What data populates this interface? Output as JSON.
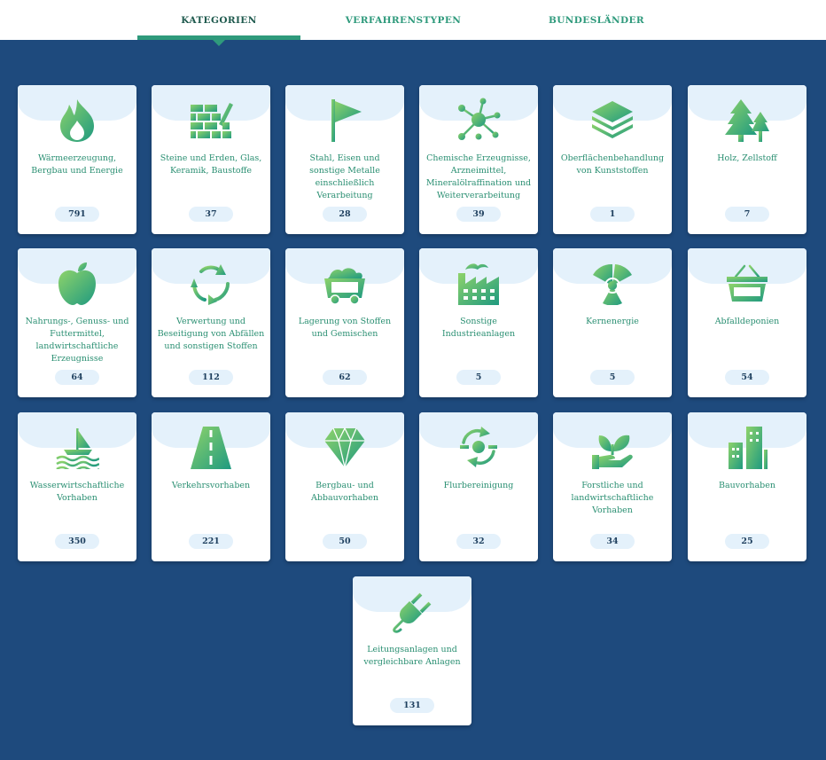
{
  "tabs": [
    {
      "label": "KATEGORIEN"
    },
    {
      "label": "VERFAHRENSTYPEN"
    },
    {
      "label": "BUNDESLÄNDER"
    }
  ],
  "colors": {
    "background": "#1e4a7d",
    "accent": "#2f9a7c",
    "card": "#ffffff",
    "pill": "#e4f1fb"
  },
  "cards": [
    {
      "label": "Wärmeerzeugung, Bergbau und Energie",
      "count": "791",
      "icon": "flame-icon"
    },
    {
      "label": "Steine und Erden, Glas, Keramik, Baustoffe",
      "count": "37",
      "icon": "brick-wall-icon"
    },
    {
      "label": "Stahl, Eisen und sonstige Metalle einschließlich Verarbeitung",
      "count": "28",
      "icon": "flag-icon"
    },
    {
      "label": "Chemische Erzeugnisse, Arzneimittel, Mineralölraffination und Weiterverarbeitung",
      "count": "39",
      "icon": "molecule-icon"
    },
    {
      "label": "Oberflächenbehandlung von Kunststoffen",
      "count": "1",
      "icon": "layers-icon"
    },
    {
      "label": "Holz, Zellstoff",
      "count": "7",
      "icon": "trees-icon"
    },
    {
      "label": "Nahrungs-, Genuss- und Futtermittel, landwirtschaftliche Erzeugnisse",
      "count": "64",
      "icon": "apple-icon"
    },
    {
      "label": "Verwertung und Beseitigung von Abfällen und sonstigen Stoffen",
      "count": "112",
      "icon": "recycle-icon"
    },
    {
      "label": "Lagerung von Stoffen und Gemischen",
      "count": "62",
      "icon": "mine-cart-icon"
    },
    {
      "label": "Sonstige Industrieanlagen",
      "count": "5",
      "icon": "factory-icon"
    },
    {
      "label": "Kernenergie",
      "count": "5",
      "icon": "radiation-icon"
    },
    {
      "label": "Abfalldeponien",
      "count": "54",
      "icon": "basket-icon"
    },
    {
      "label": "Wasserwirtschaftliche Vorhaben",
      "count": "350",
      "icon": "sailboat-icon"
    },
    {
      "label": "Verkehrsvorhaben",
      "count": "221",
      "icon": "road-icon"
    },
    {
      "label": "Bergbau- und Abbauvorhaben",
      "count": "50",
      "icon": "diamond-icon"
    },
    {
      "label": "Flurbereinigung",
      "count": "32",
      "icon": "land-cycle-icon"
    },
    {
      "label": "Forstliche und landwirtschaftliche Vorhaben",
      "count": "34",
      "icon": "plant-hand-icon"
    },
    {
      "label": "Bauvorhaben",
      "count": "25",
      "icon": "buildings-icon"
    },
    {
      "label": "Leitungsanlagen und vergleichbare Anlagen",
      "count": "131",
      "icon": "plug-icon"
    }
  ]
}
